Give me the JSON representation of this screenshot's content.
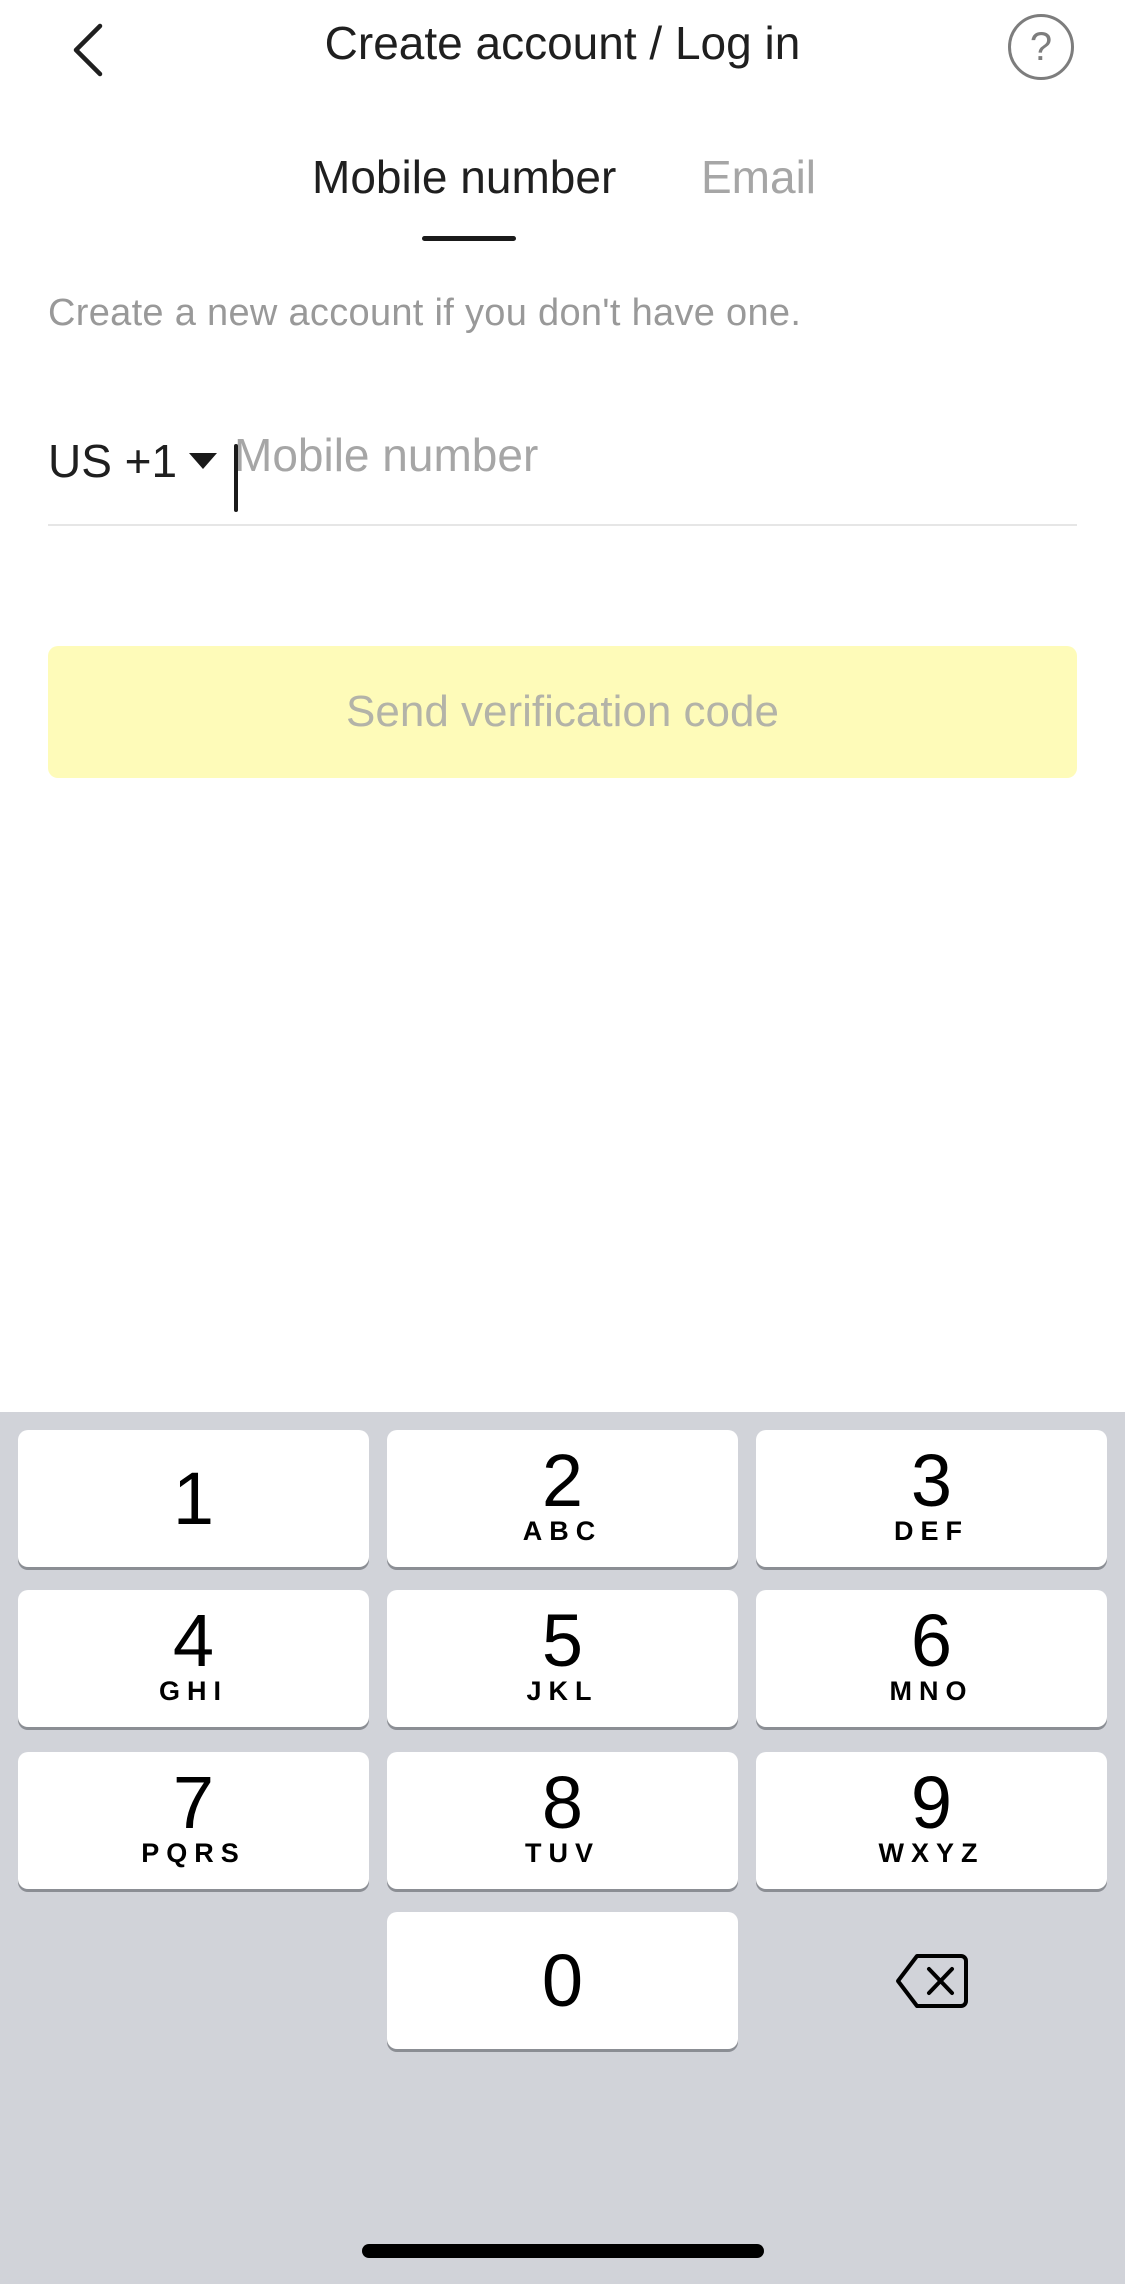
{
  "header": {
    "title": "Create account / Log in",
    "back_icon": "chevron-left-icon",
    "help_label": "?"
  },
  "tabs": [
    {
      "label": "Mobile number",
      "active": true
    },
    {
      "label": "Email",
      "active": false
    }
  ],
  "hint": "Create a new account if you don't have one.",
  "phone": {
    "country_code": "US +1",
    "placeholder": "Mobile number",
    "value": ""
  },
  "send_button": {
    "label": "Send verification code",
    "color": "#fefbb9",
    "disabled": true
  },
  "keypad": {
    "keys": [
      {
        "digit": "1",
        "letters": ""
      },
      {
        "digit": "2",
        "letters": "ABC"
      },
      {
        "digit": "3",
        "letters": "DEF"
      },
      {
        "digit": "4",
        "letters": "GHI"
      },
      {
        "digit": "5",
        "letters": "JKL"
      },
      {
        "digit": "6",
        "letters": "MNO"
      },
      {
        "digit": "7",
        "letters": "PQRS"
      },
      {
        "digit": "8",
        "letters": "TUV"
      },
      {
        "digit": "9",
        "letters": "WXYZ"
      },
      {
        "digit": "0",
        "letters": ""
      }
    ],
    "delete_icon": "backspace-icon"
  }
}
